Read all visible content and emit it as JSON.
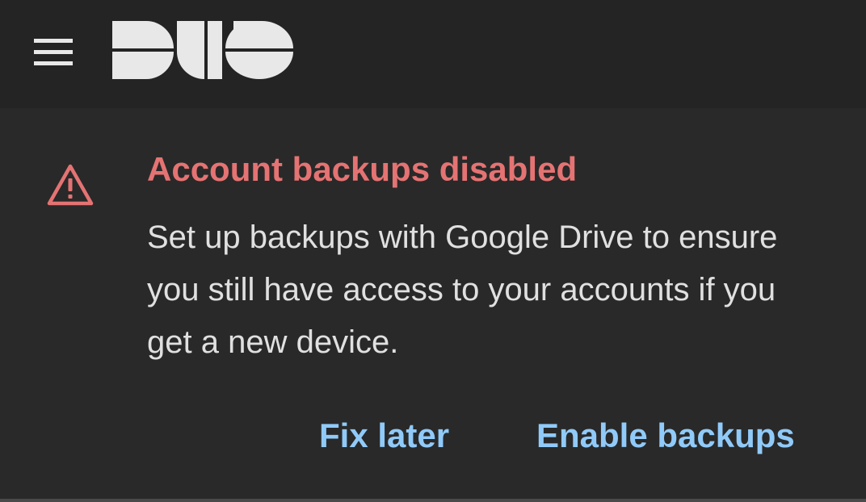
{
  "topbar": {
    "menu_icon": "hamburger-menu-icon",
    "logo_text": "DUO"
  },
  "banner": {
    "icon": "warning-triangle-icon",
    "title": "Account backups disabled",
    "message": "Set up backups with Google Drive to ensure you still have access to your accounts if you get a new device.",
    "actions": {
      "fix_later": "Fix later",
      "enable_backups": "Enable backups"
    }
  },
  "colors": {
    "background": "#292929",
    "topbar": "#242424",
    "title": "#e57373",
    "text": "#e0e0e0",
    "action": "#90caf9",
    "logo": "#e8e8e8"
  }
}
